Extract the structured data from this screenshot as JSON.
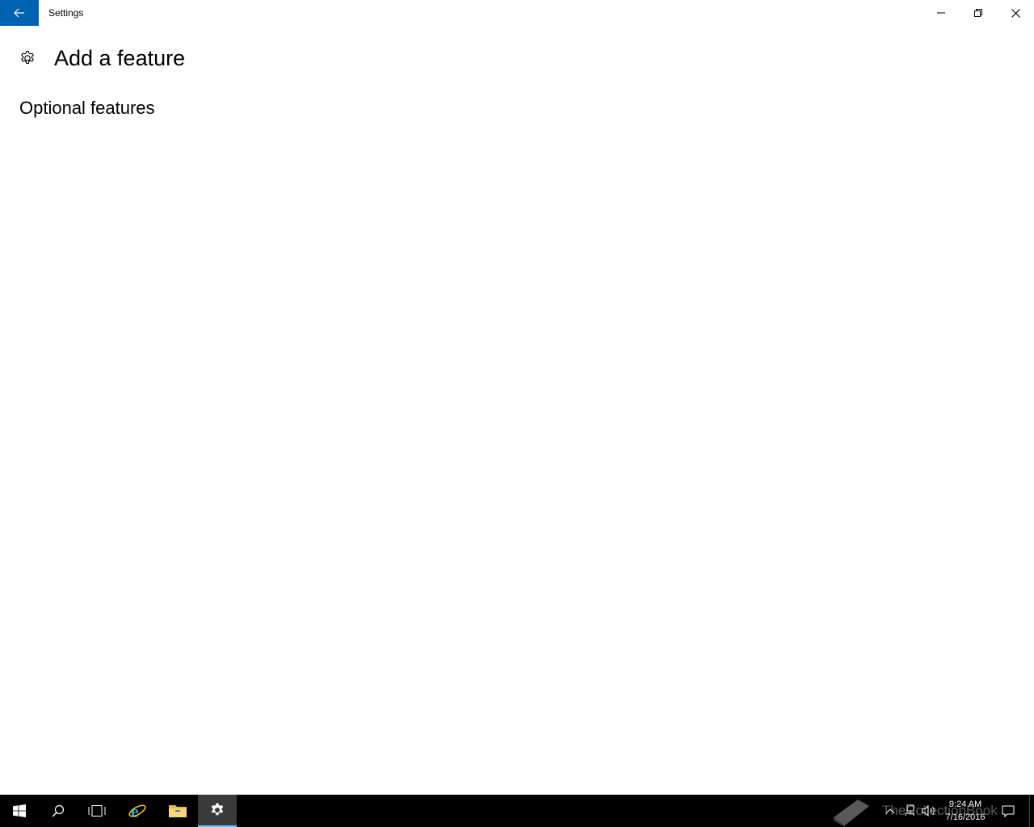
{
  "window": {
    "title": "Settings",
    "back_icon": "arrow-left-icon",
    "controls": [
      "minimize-icon",
      "restore-icon",
      "close-icon"
    ],
    "accent": "#0063b1"
  },
  "page": {
    "title": "Add a feature",
    "header_icon": "gear-icon",
    "section_title": "Optional features"
  },
  "taskbar": {
    "items": [
      "windows-start-icon",
      "search-icon",
      "task-view-icon",
      "internet-explorer-icon",
      "file-explorer-icon",
      "settings-gear-icon"
    ],
    "active_item": "settings-gear-icon",
    "tray_icons": [
      "chevron-up-icon",
      "network-icon",
      "volume-icon",
      "action-center-icon"
    ],
    "time": "9:24 AM",
    "date": "7/16/2016",
    "watermark_text": "TheCollectionBook"
  }
}
